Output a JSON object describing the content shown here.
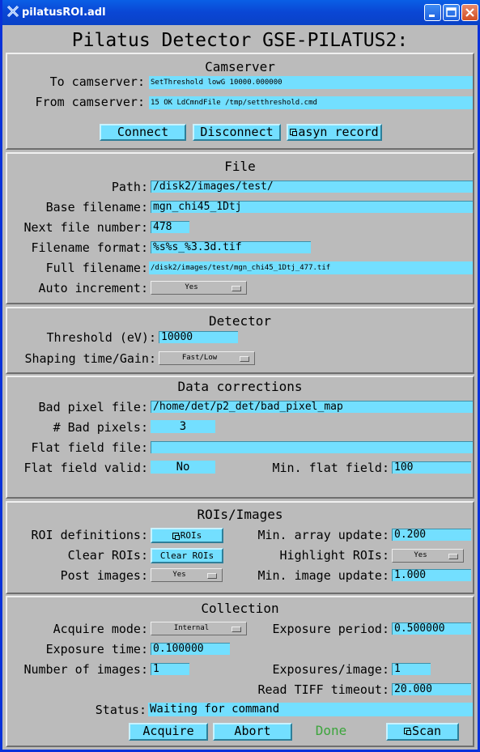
{
  "window": {
    "title": "pilatusROI.adl"
  },
  "page_title": "Pilatus Detector GSE-PILATUS2:",
  "camserver": {
    "heading": "Camserver",
    "to_label": "To camserver:",
    "to_value": "SetThreshold lowG 10000.000000",
    "from_label": "From camserver:",
    "from_value": "15 OK LdCmndFile /tmp/setthreshold.cmd",
    "connect": "Connect",
    "disconnect": "Disconnect",
    "asyn_record": "asyn record"
  },
  "file": {
    "heading": "File",
    "path_label": "Path:",
    "path_value": "/disk2/images/test/",
    "base_label": "Base filename:",
    "base_value": "mgn_chi45_1Dtj",
    "next_label": "Next file number:",
    "next_value": "478",
    "format_label": "Filename format:",
    "format_value": "%s%s_%3.3d.tif",
    "full_label": "Full filename:",
    "full_value": "/disk2/images/test/mgn_chi45_1Dtj_477.tif",
    "auto_label": "Auto increment:",
    "auto_value": "Yes"
  },
  "detector": {
    "heading": "Detector",
    "threshold_label": "Threshold (eV):",
    "threshold_value": "10000",
    "shaping_label": "Shaping time/Gain:",
    "shaping_value": "Fast/Low"
  },
  "corrections": {
    "heading": "Data corrections",
    "badfile_label": "Bad pixel file:",
    "badfile_value": "/home/det/p2_det/bad_pixel_map",
    "nbad_label": "# Bad pixels:",
    "nbad_value": "3",
    "flatfile_label": "Flat field file:",
    "flatfile_value": "",
    "flatvalid_label": "Flat field valid:",
    "flatvalid_value": "No",
    "minflat_label": "Min. flat field:",
    "minflat_value": "100"
  },
  "rois": {
    "heading": "ROIs/Images",
    "roidef_label": "ROI definitions:",
    "roidef_button": "ROIs",
    "minarray_label": "Min. array update:",
    "minarray_value": "0.200",
    "clear_label": "Clear ROIs:",
    "clear_button": "Clear ROIs",
    "highlight_label": "Highlight ROIs:",
    "highlight_value": "Yes",
    "post_label": "Post images:",
    "post_value": "Yes",
    "minimage_label": "Min. image update:",
    "minimage_value": "1.000"
  },
  "collection": {
    "heading": "Collection",
    "acqmode_label": "Acquire mode:",
    "acqmode_value": "Internal",
    "expperiod_label": "Exposure period:",
    "expperiod_value": "0.500000",
    "exptime_label": "Exposure time:",
    "exptime_value": "0.100000",
    "numimages_label": "Number of images:",
    "numimages_value": "1",
    "expimage_label": "Exposures/image:",
    "expimage_value": "1",
    "tiff_label": "Read TIFF timeout:",
    "tiff_value": "20.000",
    "status_label": "Status:",
    "status_value": "Waiting for command",
    "acquire": "Acquire",
    "abort": "Abort",
    "done": "Done",
    "scan": "Scan"
  },
  "colors": {
    "field": "#73dfff",
    "panel": "#bbbbbb",
    "done": "#3ca53c",
    "titlebar": "#0a46d4"
  }
}
